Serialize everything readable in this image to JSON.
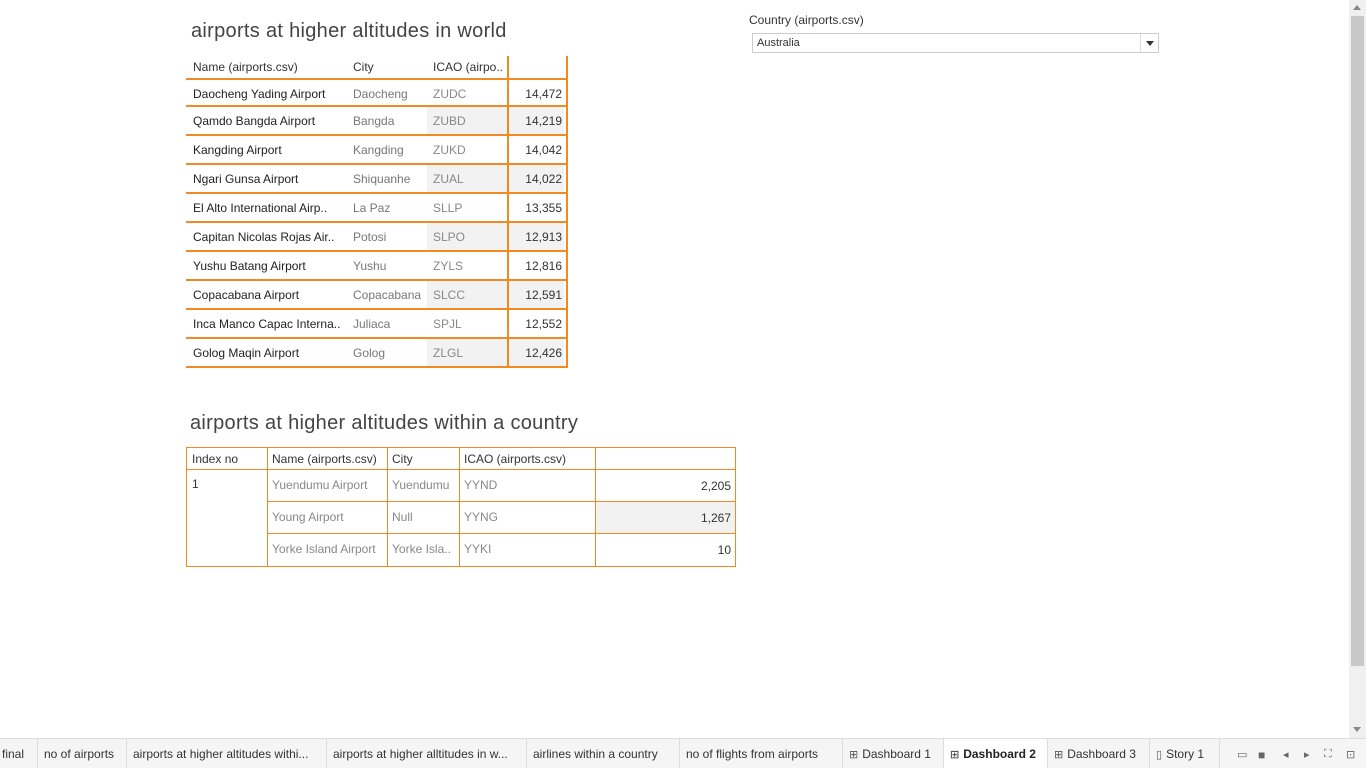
{
  "world_section": {
    "title": "airports  at  higher altitudes in world",
    "headers": {
      "name": "Name (airports.csv)",
      "city": "City",
      "icao": "ICAO (airpo.."
    },
    "rows": [
      {
        "name": "Daocheng Yading Airport",
        "city": "Daocheng",
        "icao": "ZUDC",
        "alt": "14,472"
      },
      {
        "name": "Qamdo Bangda Airport",
        "city": "Bangda",
        "icao": "ZUBD",
        "alt": "14,219"
      },
      {
        "name": "Kangding Airport",
        "city": "Kangding",
        "icao": "ZUKD",
        "alt": "14,042"
      },
      {
        "name": "Ngari Gunsa Airport",
        "city": "Shiquanhe",
        "icao": "ZUAL",
        "alt": "14,022"
      },
      {
        "name": "El Alto International Airp..",
        "city": "La Paz",
        "icao": "SLLP",
        "alt": "13,355"
      },
      {
        "name": "Capitan Nicolas Rojas Air..",
        "city": "Potosi",
        "icao": "SLPO",
        "alt": "12,913"
      },
      {
        "name": "Yushu Batang Airport",
        "city": "Yushu",
        "icao": "ZYLS",
        "alt": "12,816"
      },
      {
        "name": "Copacabana Airport",
        "city": "Copacabana",
        "icao": "SLCC",
        "alt": "12,591"
      },
      {
        "name": "Inca Manco Capac Interna..",
        "city": "Juliaca",
        "icao": "SPJL",
        "alt": "12,552"
      },
      {
        "name": "Golog Maqin Airport",
        "city": "Golog",
        "icao": "ZLGL",
        "alt": "12,426"
      }
    ]
  },
  "country_section": {
    "title": "airports at  higher altitudes within  a  country",
    "headers": {
      "index": "Index no",
      "name": "Name (airports.csv)",
      "city": "City",
      "icao": "ICAO (airports.csv)"
    },
    "index_value": "1",
    "rows": [
      {
        "name": "Yuendumu Airport",
        "city": "Yuendumu",
        "icao": "YYND",
        "alt": "2,205"
      },
      {
        "name": "Young Airport",
        "city": "Null",
        "icao": "YYNG",
        "alt": "1,267"
      },
      {
        "name": "Yorke Island Airport",
        "city": "Yorke Isla..",
        "icao": "YYKI",
        "alt": "10"
      }
    ]
  },
  "filter": {
    "label": "Country (airports.csv)",
    "value": "Australia"
  },
  "tabs": [
    {
      "label": "final",
      "icon": ""
    },
    {
      "label": "no of airports",
      "icon": ""
    },
    {
      "label": "airports  at higher altitudes withi...",
      "icon": ""
    },
    {
      "label": "airports at higher alltitudes in w...",
      "icon": ""
    },
    {
      "label": "airlines  within a country",
      "icon": ""
    },
    {
      "label": "no of flights from airports",
      "icon": ""
    },
    {
      "label": "Dashboard 1",
      "icon": "dashboard-icon"
    },
    {
      "label": "Dashboard 2",
      "icon": "dashboard-icon"
    },
    {
      "label": "Dashboard 3",
      "icon": "dashboard-icon"
    },
    {
      "label": "Story 1",
      "icon": "story-icon"
    }
  ],
  "active_tab": "Dashboard 2",
  "colors": {
    "accent": "#f08a24",
    "shade": "#f2f2f2"
  }
}
